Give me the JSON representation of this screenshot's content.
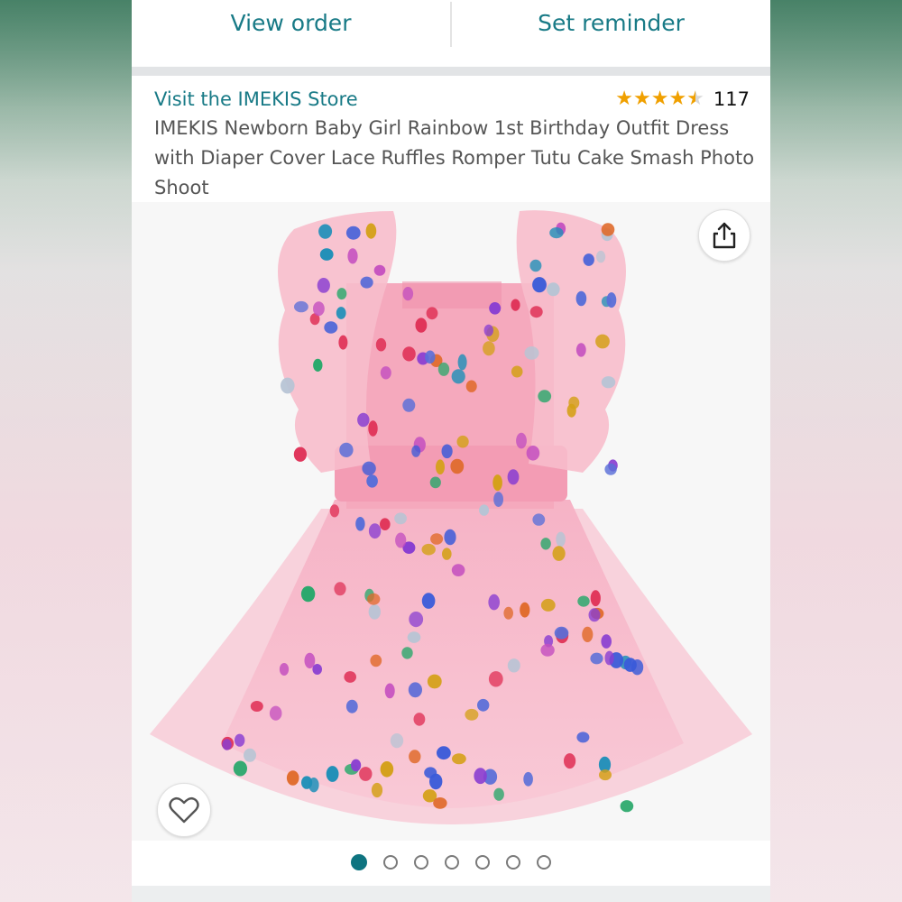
{
  "actions": {
    "view_order": "View order",
    "set_reminder": "Set reminder"
  },
  "product": {
    "store_link": "Visit the IMEKIS Store",
    "rating_count": "117",
    "rating_value": 4.5,
    "title": "IMEKIS Newborn Baby Girl Rainbow 1st Birthday Outfit Dress with Diaper Cover Lace Ruffles Romper Tutu Cake Smash Photo Shoot"
  },
  "gallery": {
    "image_count": 7,
    "active_index": 0
  },
  "icons": {
    "share": "share-icon",
    "heart": "heart-icon",
    "star": "star-icon"
  },
  "colors": {
    "link": "#187a86",
    "star": "#f0a000",
    "dress_pink": "#f7b8c8",
    "active_dot": "#0e7480"
  }
}
